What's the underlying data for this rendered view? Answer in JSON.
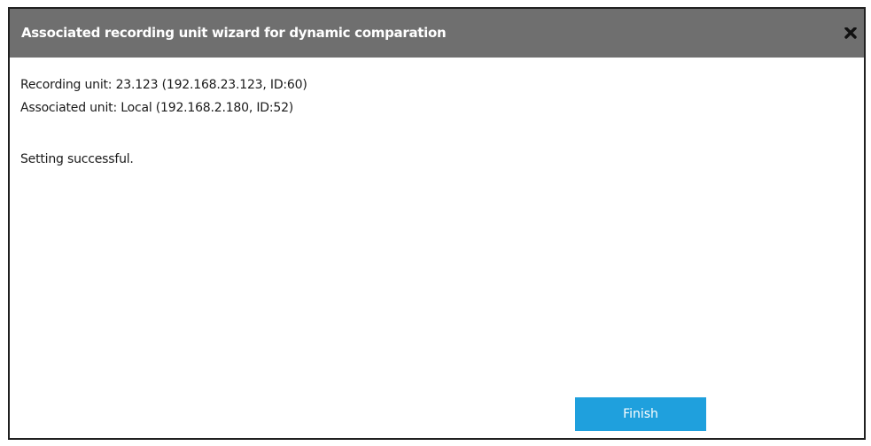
{
  "dialog": {
    "title": "Associated recording unit wizard for dynamic comparation",
    "close_icon": "close-x-icon",
    "colors": {
      "titlebar_bg": "#6f6f6f",
      "button_bg": "#1fa0dd",
      "border": "#202020"
    }
  },
  "content": {
    "recording_unit": "Recording unit: 23.123 (192.168.23.123, ID:60)",
    "associated_unit": "Associated unit: Local (192.168.2.180, ID:52)",
    "status": "Setting successful."
  },
  "buttons": {
    "finish_label": "Finish"
  }
}
